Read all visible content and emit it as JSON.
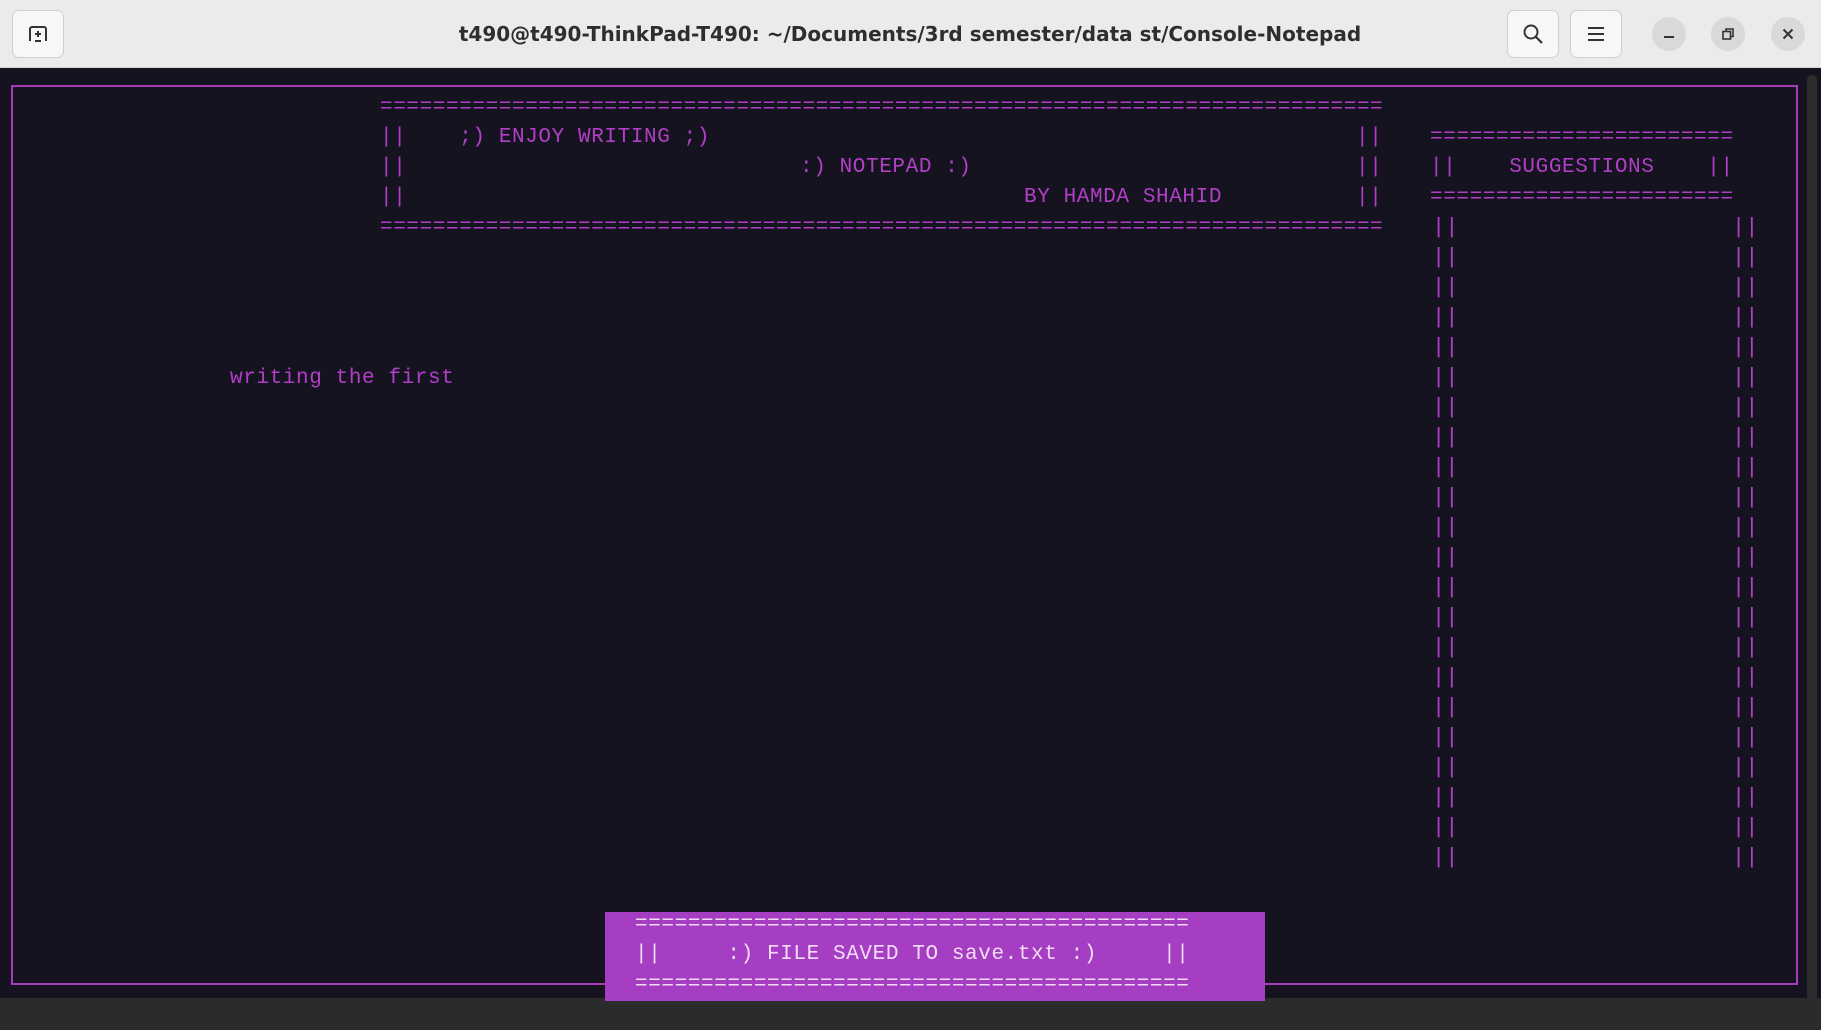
{
  "window": {
    "title": "t490@t490-ThinkPad-T490: ~/Documents/3rd semester/data st/Console-Notepad",
    "new_tab_icon": "new-tab-icon",
    "search_icon": "search-icon",
    "menu_icon": "hamburger-menu-icon",
    "minimize_icon": "minimize-icon",
    "maximize_icon": "restore-icon",
    "close_icon": "close-icon"
  },
  "header": {
    "rule": "=========================================================================================",
    "line1": "||    ;) ENJOY WRITING ;)",
    "line2": ":) NOTEPAD :)",
    "line3": "BY HAMDA SHAHID",
    "bar": "||"
  },
  "suggestions": {
    "rule": "=======================",
    "title_line": "||    SUGGESTIONS    ||",
    "bar": "||"
  },
  "editor": {
    "text": "writing the first"
  },
  "status_banner": {
    "rule": "==========================================",
    "message": "||     :) FILE SAVED TO save.txt :)     ||"
  },
  "colors": {
    "accent": "#b03fc6",
    "banner_bg": "#a63ec3",
    "terminal_bg": "#161320"
  }
}
